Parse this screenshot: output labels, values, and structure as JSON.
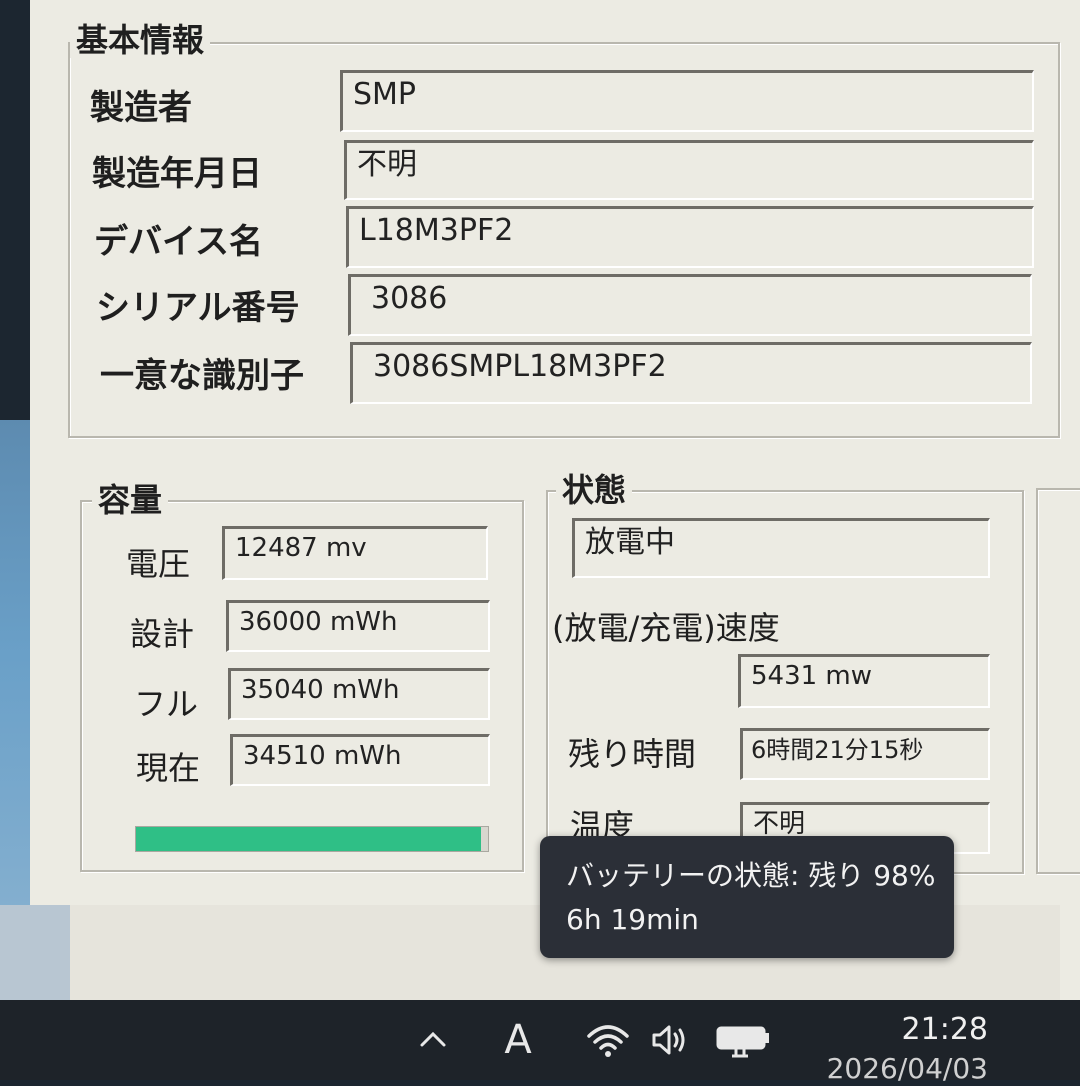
{
  "basic": {
    "title": "基本情報",
    "rows": [
      {
        "label": "製造者",
        "value": "SMP"
      },
      {
        "label": "製造年月日",
        "value": "不明"
      },
      {
        "label": "デバイス名",
        "value": "L18M3PF2"
      },
      {
        "label": "シリアル番号",
        "value": "3086"
      },
      {
        "label": "一意な識別子",
        "value": "3086SMPL18M3PF2"
      }
    ]
  },
  "capacity": {
    "title": "容量",
    "rows": [
      {
        "label": "電圧",
        "value": "12487 mv"
      },
      {
        "label": "設計",
        "value": "36000 mWh"
      },
      {
        "label": "フル",
        "value": "35040 mWh"
      },
      {
        "label": "現在",
        "value": "34510 mWh"
      }
    ],
    "charge_fraction": 0.98,
    "bar_color": "#2fbf86"
  },
  "status": {
    "title": "状態",
    "state_value": "放電中",
    "rate_label": "(放電/充電)速度",
    "rate_value": "5431 mw",
    "remaining_label": "残り時間",
    "remaining_value": "6時間21分15秒",
    "temp_label": "温度",
    "temp_value": "不明"
  },
  "tooltip": {
    "line1": "バッテリーの状態: 残り 98%",
    "line2": "6h 19min"
  },
  "taskbar": {
    "ime_label": "A",
    "time": "21:28",
    "date": "2026/04/03",
    "icons": [
      "chevron-up-icon",
      "wifi-icon",
      "speaker-icon",
      "battery-plugged-icon"
    ]
  }
}
